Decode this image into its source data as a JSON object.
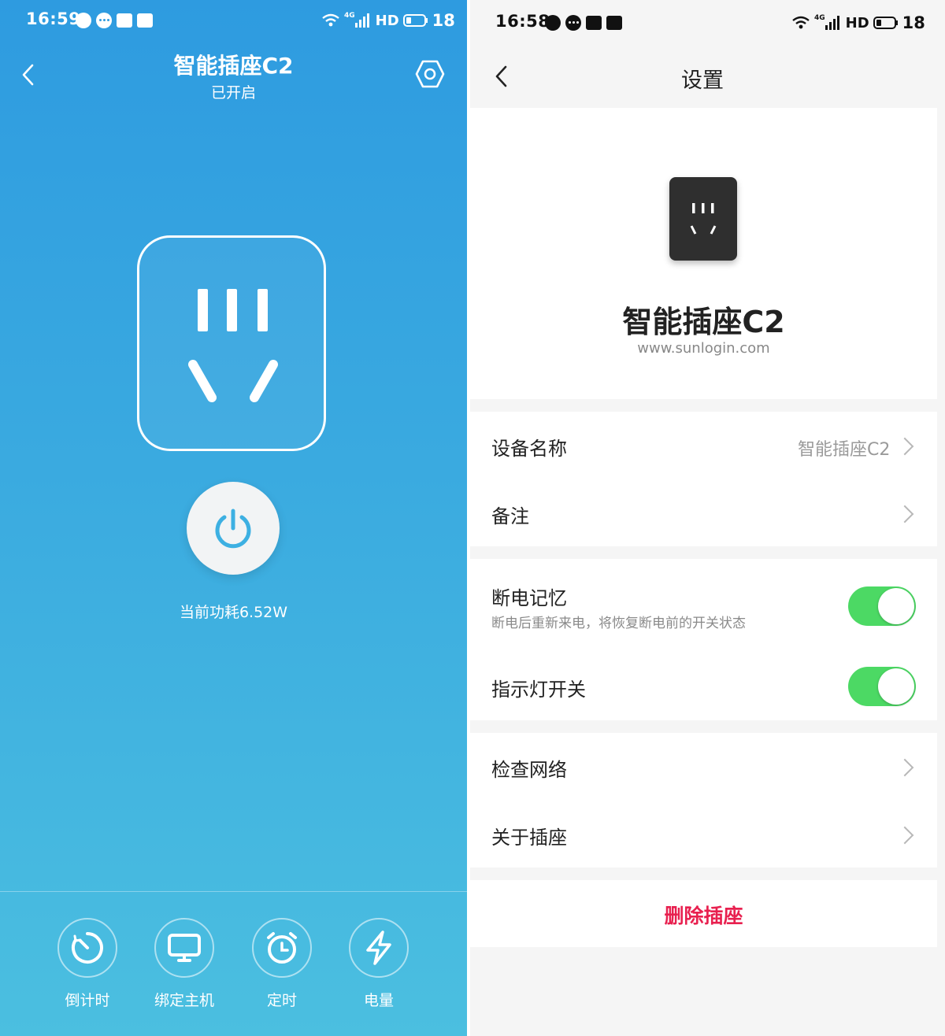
{
  "left_screen": {
    "status_bar": {
      "time": "16:59",
      "network": "4G",
      "hd": "HD",
      "battery": "18"
    },
    "header": {
      "title": "智能插座C2",
      "subtitle": "已开启"
    },
    "power_label": "当前功耗6.52W",
    "tools": [
      {
        "label": "倒计时",
        "icon": "countdown-icon"
      },
      {
        "label": "绑定主机",
        "icon": "monitor-icon"
      },
      {
        "label": "定时",
        "icon": "alarm-clock-icon"
      },
      {
        "label": "电量",
        "icon": "lightning-icon"
      }
    ],
    "colors": {
      "gradient_top": "#2e9be0",
      "gradient_bottom": "#4bbfe0",
      "power_icon": "#3db0e2"
    }
  },
  "right_screen": {
    "status_bar": {
      "time": "16:58",
      "network": "4G",
      "hd": "HD",
      "battery": "18"
    },
    "header": {
      "title": "设置"
    },
    "device": {
      "name": "智能插座C2",
      "url": "www.sunlogin.com"
    },
    "rows": {
      "device_name": {
        "label": "设备名称",
        "value": "智能插座C2"
      },
      "remark": {
        "label": "备注"
      },
      "power_memory": {
        "label": "断电记忆",
        "description": "断电后重新来电，将恢复断电前的开关状态",
        "enabled": true
      },
      "indicator": {
        "label": "指示灯开关",
        "enabled": true
      },
      "check_network": {
        "label": "检查网络"
      },
      "about": {
        "label": "关于插座"
      }
    },
    "delete_label": "删除插座",
    "colors": {
      "toggle_on": "#4cd964",
      "danger": "#e8204f",
      "background": "#f5f5f5"
    }
  }
}
